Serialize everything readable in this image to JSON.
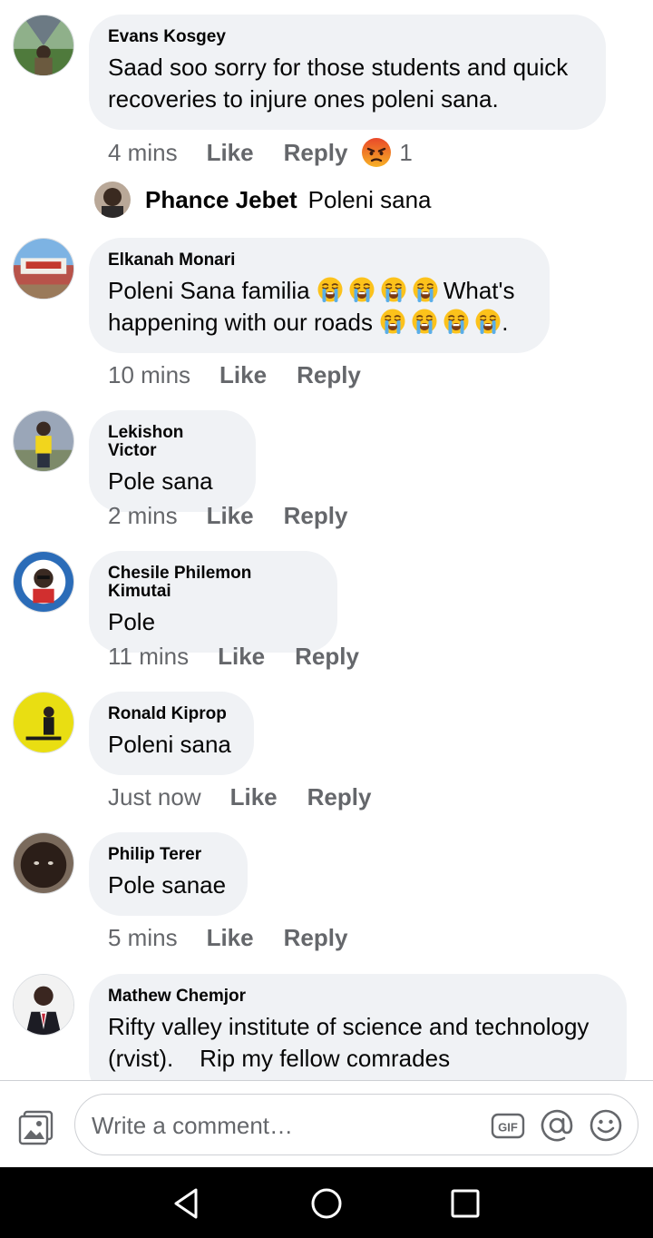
{
  "comments": [
    {
      "author": "Evans Kosgey",
      "text": "Saad soo sorry for those students and quick\nrecoveries to injure ones poleni sana.",
      "time": "4 mins",
      "like_label": "Like",
      "reply_label": "Reply",
      "reaction": {
        "icon": "angry-reaction-icon",
        "count": "1"
      }
    },
    {
      "author": "Elkanah Monari",
      "text_line1_before": "Poleni Sana familia",
      "text_line1_after": "What's",
      "text_line2_before": "happening with our roads",
      "text_line2_after": ".",
      "emoji": "loudly-crying-face-emoji",
      "time": "10 mins",
      "like_label": "Like",
      "reply_label": "Reply"
    },
    {
      "author": "Lekishon Victor",
      "text": "Pole sana",
      "time": "2 mins",
      "like_label": "Like",
      "reply_label": "Reply"
    },
    {
      "author": "Chesile Philemon Kimutai",
      "text": "Pole",
      "time": "11 mins",
      "like_label": "Like",
      "reply_label": "Reply"
    },
    {
      "author": "Ronald Kiprop",
      "text": "Poleni sana",
      "time": "Just now",
      "like_label": "Like",
      "reply_label": "Reply"
    },
    {
      "author": "Philip Terer",
      "text": "Pole sanae",
      "time": "5 mins",
      "like_label": "Like",
      "reply_label": "Reply"
    },
    {
      "author": "Mathew Chemjor",
      "text": "Rifty valley institute of science and technology\n(rvist).    Rip my fellow comrades"
    }
  ],
  "reply_preview": {
    "author": "Phance Jebet",
    "text": "Poleni sana"
  },
  "composer": {
    "placeholder": "Write a comment…",
    "icons": [
      "photo-icon",
      "gif-icon",
      "mention-icon",
      "emoji-icon"
    ]
  },
  "navigation": {
    "icons": [
      "back-icon",
      "home-icon",
      "recents-icon"
    ]
  },
  "colors": {
    "bubble": "#f0f2f5",
    "secondary_text": "#65676b",
    "primary_text": "#050505",
    "divider": "#ced0d4",
    "nav_bar": "#000000"
  }
}
